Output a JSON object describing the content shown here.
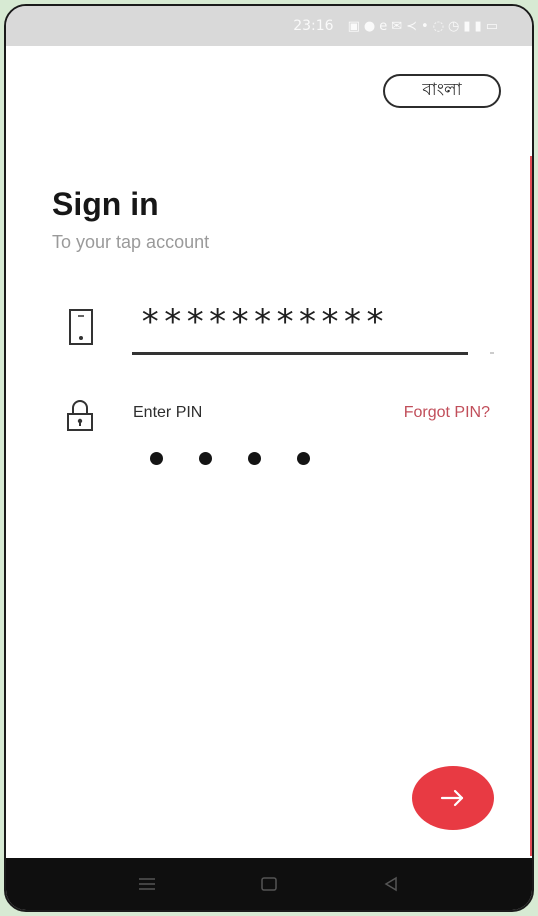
{
  "status_bar": {
    "time": "23:16",
    "icons": [
      "message-icon",
      "messenger-icon",
      "browser-icon",
      "mail-icon",
      "share-icon",
      "dot-icon",
      "alarm-icon",
      "clock-icon",
      "signal-icon",
      "signal-icon",
      "battery-icon"
    ]
  },
  "language_button": {
    "label": "বাংলা"
  },
  "header": {
    "title": "Sign in",
    "subtitle": "To your tap account"
  },
  "phone": {
    "value": "***********"
  },
  "pin": {
    "label": "Enter PIN",
    "forgot_label": "Forgot PIN?",
    "filled": 4
  },
  "colors": {
    "accent": "#e83a43",
    "link": "#c14e5a"
  }
}
